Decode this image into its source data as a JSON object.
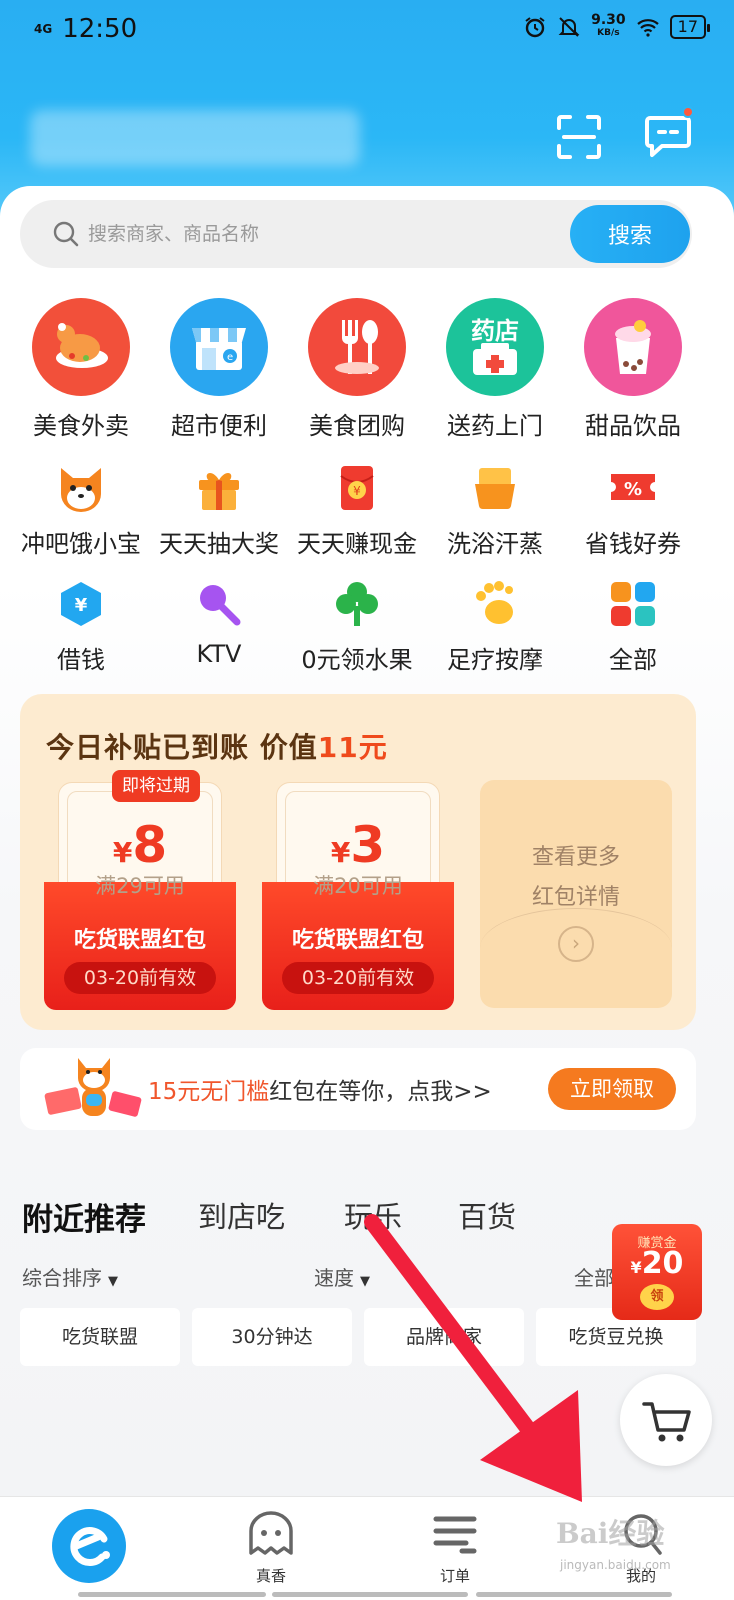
{
  "status_bar": {
    "network": "4G",
    "time": "12:50",
    "speed": "9.30",
    "speed_unit": "KB/s",
    "battery": "17"
  },
  "search": {
    "placeholder": "搜索商家、商品名称",
    "button": "搜索"
  },
  "categories_main": [
    {
      "label": "美食外卖",
      "icon": "roast-chicken-icon",
      "color": "#f2503a"
    },
    {
      "label": "超市便利",
      "icon": "store-icon",
      "color": "#2aa6f0"
    },
    {
      "label": "美食团购",
      "icon": "cutlery-icon",
      "color": "#f24a3c"
    },
    {
      "label": "送药上门",
      "icon": "pharmacy-icon",
      "color": "#1cc39a",
      "badge": "药店"
    },
    {
      "label": "甜品饮品",
      "icon": "bubble-tea-icon",
      "color": "#f0569b"
    }
  ],
  "categories_row2": [
    {
      "label": "冲吧饿小宝",
      "icon": "shiba-dog-icon"
    },
    {
      "label": "天天抽大奖",
      "icon": "gift-box-icon"
    },
    {
      "label": "天天赚现金",
      "icon": "red-envelope-icon"
    },
    {
      "label": "洗浴汗蒸",
      "icon": "bath-tub-icon"
    },
    {
      "label": "省钱好券",
      "icon": "coupon-ticket-icon"
    }
  ],
  "categories_row3": [
    {
      "label": "借钱",
      "icon": "yuan-hexagon-icon"
    },
    {
      "label": "KTV",
      "icon": "microphone-icon"
    },
    {
      "label": "0元领水果",
      "icon": "tree-icon"
    },
    {
      "label": "足疗按摩",
      "icon": "footprint-icon"
    },
    {
      "label": "全部",
      "icon": "grid-apps-icon"
    }
  ],
  "subsidy": {
    "title_a": "今日补贴已到账  价值",
    "title_value": "11元",
    "coupons": [
      {
        "currency": "¥",
        "amount": "8",
        "condition": "满29可用",
        "name": "吃货联盟红包",
        "valid": "03-20前有效",
        "tag": "即将过期"
      },
      {
        "currency": "¥",
        "amount": "3",
        "condition": "满20可用",
        "name": "吃货联盟红包",
        "valid": "03-20前有效"
      }
    ],
    "more_line1": "查看更多",
    "more_line2": "红包详情"
  },
  "promo": {
    "highlight": "15元无门槛",
    "text": "红包在等你，点我>>",
    "button": "立即领取"
  },
  "tabs": [
    "附近推荐",
    "到店吃",
    "玩乐",
    "百货"
  ],
  "sorts": [
    "综合排序",
    "速度",
    "全部"
  ],
  "filters": [
    "吃货联盟",
    "30分钟达",
    "品牌商家",
    "吃货豆兑换"
  ],
  "float_packet": {
    "top": "赚赏金",
    "amount": "20",
    "currency": "¥",
    "coin": "领"
  },
  "bottom_nav": [
    {
      "label": "",
      "icon": "eleme-home-icon"
    },
    {
      "label": "真香",
      "icon": "ghost-icon"
    },
    {
      "label": "订单",
      "icon": "order-list-icon"
    },
    {
      "label": "我的",
      "icon": "user-profile-icon"
    }
  ],
  "watermark": {
    "main": "Bai经验",
    "sub": "jingyan.baidu.com"
  },
  "colors": {
    "brand": "#1ea2ee",
    "accent_red": "#ef3b23",
    "promo_orange": "#f57a1f"
  }
}
